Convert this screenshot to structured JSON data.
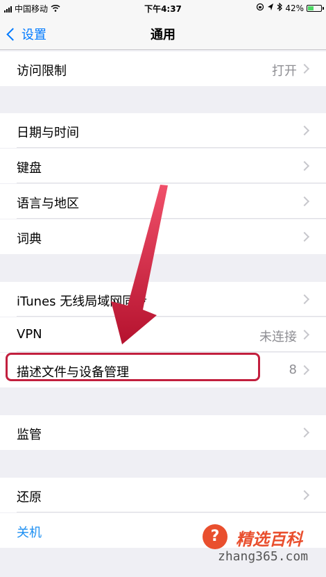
{
  "status_bar": {
    "carrier": "中国移动",
    "time": "下午4:37",
    "battery_percent": "42%",
    "battery_level": 0.42
  },
  "nav": {
    "back_label": "设置",
    "title": "通用"
  },
  "rows": {
    "restrictions": {
      "label": "访问限制",
      "value": "打开"
    },
    "date_time": {
      "label": "日期与时间"
    },
    "keyboard": {
      "label": "键盘"
    },
    "language_region": {
      "label": "语言与地区"
    },
    "dictionary": {
      "label": "词典"
    },
    "itunes_wifi_sync": {
      "label": "iTunes 无线局域网同步"
    },
    "vpn": {
      "label": "VPN",
      "value": "未连接"
    },
    "profiles": {
      "label": "描述文件与设备管理",
      "value": "8"
    },
    "supervision": {
      "label": "监管"
    },
    "reset": {
      "label": "还原"
    },
    "shutdown": {
      "label": "关机"
    }
  },
  "watermark": {
    "badge": "?",
    "title": "精选百科",
    "url": "zhang365.com"
  }
}
